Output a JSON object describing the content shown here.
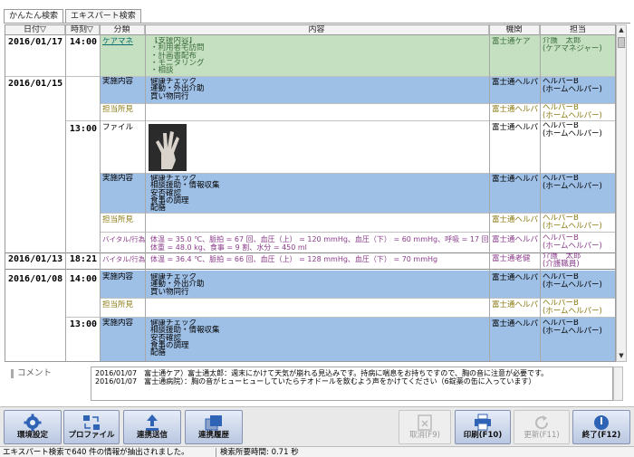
{
  "tabs": [
    "かんたん検索",
    "エキスパート検索"
  ],
  "columns": [
    "日付▽",
    "時刻▽",
    "分類",
    "内容",
    "機関",
    "担当"
  ],
  "rows": [
    {
      "date": "2016/01/17",
      "time": "14:00",
      "type": "ケアマネ",
      "content": "【支援内容】\n・利用者宅訪問\n・計画書配布\n・モニタリング\n・相談",
      "org": "富士通ケア",
      "staff": "介護　太郎\n(ケアマネジャー)"
    },
    {
      "date": "2016/01/15",
      "time": "",
      "type": "実施内容",
      "content": "健康チェック\n運動・外出介助\n買い物同行",
      "org": "富士通ヘルパ",
      "staff": "ヘルパーB\n(ホームヘルパー)"
    },
    {
      "date": "",
      "time": "",
      "type": "担当所見",
      "content": "",
      "org": "富士通ヘルパ",
      "staff": "ヘルパーB\n(ホームヘルパー)"
    },
    {
      "date": "",
      "time": "13:00",
      "type": "ファイル",
      "content": "",
      "org": "富士通ヘルパ",
      "staff": "ヘルパーB\n(ホームヘルパー)"
    },
    {
      "date": "",
      "time": "",
      "type": "実施内容",
      "content": "健康チェック\n相談援助・情報収集\n安否確認\n食事の調理\n配膳",
      "org": "富士通ヘルパ",
      "staff": "ヘルパーB\n(ホームヘルパー)"
    },
    {
      "date": "",
      "time": "",
      "type": "担当所見",
      "content": "",
      "org": "富士通ヘルパ",
      "staff": "ヘルパーB\n(ホームヘルパー)"
    },
    {
      "date": "",
      "time": "",
      "type": "バイタル/行為",
      "content": "体温 = 35.0 ℃、脈拍 = 67 回、血圧（上） = 120 mmHg、血圧（下） = 60 mmHg、呼吸 = 17 回、\n体重 = 48.0 kg、食事 = 9 割、水分 = 450 ml",
      "org": "富士通ヘルパ",
      "staff": "ヘルパーB\n(ホームヘルパー)"
    },
    {
      "date": "2016/01/13",
      "time": "18:21",
      "type": "バイタル/行為",
      "content": "体温 = 36.4 ℃、脈拍 = 66 回、血圧（上） = 128 mmHg、血圧（下） = 70 mmHg",
      "org": "富士通老健",
      "staff": "介護　太郎\n(介護職員)"
    },
    {
      "date": "2016/01/08",
      "time": "14:00",
      "type": "実施内容",
      "content": "健康チェック\n運動・外出介助\n買い物同行",
      "org": "富士通ヘルパ",
      "staff": "ヘルパーB\n(ホームヘルパー)"
    },
    {
      "date": "",
      "time": "",
      "type": "担当所見",
      "content": "",
      "org": "富士通ヘルパ",
      "staff": "ヘルパーB\n(ホームヘルパー)"
    },
    {
      "date": "",
      "time": "13:00",
      "type": "実施内容",
      "content": "健康チェック\n相談援助・情報収集\n安否確認\n食事の調理\n配膳",
      "org": "富士通ヘルパ",
      "staff": "ヘルパーB\n(ホームヘルパー)"
    }
  ],
  "comment": {
    "label": "コメント",
    "lines": [
      "2016/01/07　富士通ケア）富士通太郎：週末にかけて天気が崩れる見込みです。持病に喘息をお持ちですので、胸の音に注意が必要です。",
      "2016/01/07　富士通病院）：胸の音がヒューヒューしていたらテオドールを飲むよう声をかけてください（6錠薬の缶に入っています）"
    ]
  },
  "toolbar": {
    "env_label": "環境設定",
    "profile_label": "プロファイル",
    "send_label": "連携送信",
    "history_label": "連携履歴",
    "cancel_label": "取消(F9)",
    "print_label": "印刷(F10)",
    "update_label": "更新(F11)",
    "exit_label": "終了(F12)"
  },
  "status": {
    "message": "エキスパート検索で640 件の情報が抽出されました。",
    "time": "検索所要時間: 0.71 秒"
  },
  "colors": {
    "band_green": "#c5e0c1",
    "band_blue": "#9ebfe6",
    "observation_text": "#8a7a10",
    "vital_text": "#8b3c8b"
  }
}
